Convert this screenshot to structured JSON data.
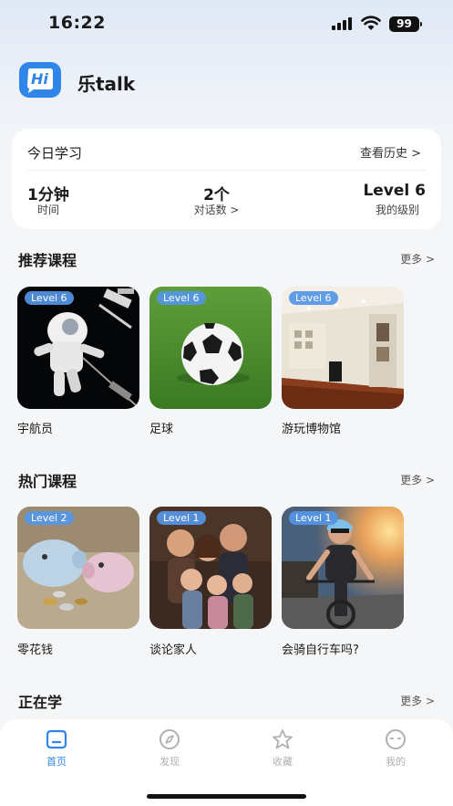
{
  "status_bar": {
    "time": "16:22",
    "battery": "99",
    "icons": [
      "signal-icon",
      "wifi-icon",
      "battery-icon"
    ]
  },
  "header": {
    "logo_text": "Hi",
    "app_name": "乐talk"
  },
  "today": {
    "title": "今日学习",
    "history_link": "查看历史 >",
    "stats": [
      {
        "value": "1分钟",
        "label": "时间"
      },
      {
        "value": "2个",
        "label": "对话数 >"
      },
      {
        "value": "Level 6",
        "label": "我的级别"
      }
    ]
  },
  "recommended": {
    "title": "推荐课程",
    "more": "更多 >",
    "courses": [
      {
        "name": "宇航员",
        "level": "Level 6",
        "image": "astronaut"
      },
      {
        "name": "足球",
        "level": "Level 6",
        "image": "soccer-ball"
      },
      {
        "name": "游玩博物馆",
        "level": "Level 6",
        "image": "museum"
      }
    ]
  },
  "popular": {
    "title": "热门课程",
    "more": "更多 >",
    "courses": [
      {
        "name": "零花钱",
        "level": "Level 2",
        "image": "piggy-banks"
      },
      {
        "name": "谈论家人",
        "level": "Level 1",
        "image": "family"
      },
      {
        "name": "会骑自行车吗?",
        "level": "Level 1",
        "image": "cyclist"
      }
    ]
  },
  "learning": {
    "title": "正在学",
    "more": "更多 >"
  },
  "tab_bar": {
    "tabs": [
      {
        "label": "首页",
        "icon": "home-icon",
        "active": true
      },
      {
        "label": "发现",
        "icon": "compass-icon",
        "active": false
      },
      {
        "label": "收藏",
        "icon": "star-icon",
        "active": false
      },
      {
        "label": "我的",
        "icon": "profile-icon",
        "active": false
      }
    ]
  },
  "colors": {
    "accent": "#2f86e8",
    "badge": "#5596e6",
    "tab_inactive": "#b0b0b0",
    "background": "#f5f6f8"
  }
}
